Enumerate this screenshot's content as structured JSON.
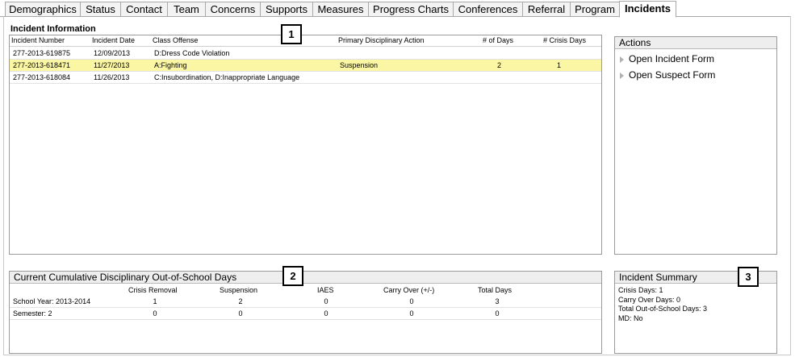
{
  "tabs": [
    {
      "label": "Demographics",
      "active": false
    },
    {
      "label": "Status",
      "active": false
    },
    {
      "label": "Contact",
      "active": false
    },
    {
      "label": "Team",
      "active": false
    },
    {
      "label": "Concerns",
      "active": false
    },
    {
      "label": "Supports",
      "active": false
    },
    {
      "label": "Measures",
      "active": false
    },
    {
      "label": "Progress Charts",
      "active": false
    },
    {
      "label": "Conferences",
      "active": false
    },
    {
      "label": "Referral",
      "active": false
    },
    {
      "label": "Program",
      "active": false
    },
    {
      "label": "Incidents",
      "active": true
    }
  ],
  "incident_info": {
    "title": "Incident Information",
    "columns": [
      "Incident Number",
      "Incident Date",
      "Class Offense",
      "Primary Disciplinary Action",
      "# of Days",
      "# Crisis Days"
    ],
    "rows": [
      {
        "number": "277-2013-619875",
        "date": "12/09/2013",
        "offense": "D:Dress Code Violation",
        "action": "",
        "days": "",
        "crisis_days": "",
        "selected": false
      },
      {
        "number": "277-2013-618471",
        "date": "11/27/2013",
        "offense": "A:Fighting",
        "action": "Suspension",
        "days": "2",
        "crisis_days": "1",
        "selected": true
      },
      {
        "number": "277-2013-618084",
        "date": "11/26/2013",
        "offense": "C:Insubordination, D:Inappropriate Language",
        "action": "",
        "days": "",
        "crisis_days": "",
        "selected": false
      }
    ]
  },
  "actions": {
    "title": "Actions",
    "items": [
      "Open Incident Form",
      "Open Suspect Form"
    ]
  },
  "cumulative": {
    "title": "Current Cumulative Disciplinary Out-of-School Days",
    "columns": [
      "Crisis Removal",
      "Suspension",
      "IAES",
      "Carry Over (+/-)",
      "Total Days"
    ],
    "rows": [
      {
        "label": "School Year: 2013-2014",
        "values": [
          "1",
          "2",
          "0",
          "0",
          "3"
        ]
      },
      {
        "label": "Semester: 2",
        "values": [
          "0",
          "0",
          "0",
          "0",
          "0"
        ]
      }
    ]
  },
  "summary": {
    "title": "Incident Summary",
    "lines": [
      "Crisis Days: 1",
      "Carry Over Days: 0",
      "Total Out-of-School Days: 3",
      "MD: No"
    ]
  },
  "callouts": [
    "1",
    "2",
    "3"
  ],
  "colors": {
    "selected_row": "#fbf6a3",
    "panel_header": "#eeeeee"
  }
}
